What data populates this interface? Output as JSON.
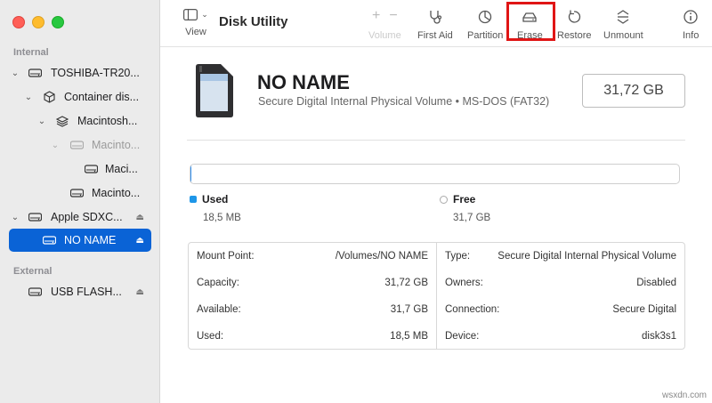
{
  "toolbar": {
    "view_label": "View",
    "app_title": "Disk Utility",
    "buttons": [
      {
        "label": "Volume",
        "icon": "plus-minus-icon"
      },
      {
        "label": "First Aid",
        "icon": "stethoscope-icon"
      },
      {
        "label": "Partition",
        "icon": "pie-icon"
      },
      {
        "label": "Erase",
        "icon": "erase-disk-icon"
      },
      {
        "label": "Restore",
        "icon": "restore-arrow-icon"
      },
      {
        "label": "Unmount",
        "icon": "unmount-icon"
      },
      {
        "label": "Info",
        "icon": "info-icon"
      }
    ]
  },
  "sidebar": {
    "internal_label": "Internal",
    "external_label": "External",
    "items": [
      {
        "label": "TOSHIBA-TR20..."
      },
      {
        "label": "Container dis..."
      },
      {
        "label": "Macintosh..."
      },
      {
        "label": "Macinto..."
      },
      {
        "label": "Maci..."
      },
      {
        "label": "Macinto..."
      },
      {
        "label": "Apple SDXC..."
      },
      {
        "label": "NO NAME"
      },
      {
        "label": "USB FLASH..."
      }
    ]
  },
  "volume": {
    "name": "NO NAME",
    "subtitle": "Secure Digital Internal Physical Volume • MS-DOS (FAT32)",
    "size": "31,72 GB",
    "used_fraction": 0.0006
  },
  "usage": {
    "used_label": "Used",
    "used_value": "18,5 MB",
    "free_label": "Free",
    "free_value": "31,7 GB"
  },
  "info": {
    "left": [
      {
        "key": "Mount Point:",
        "value": "/Volumes/NO NAME"
      },
      {
        "key": "Capacity:",
        "value": "31,72 GB"
      },
      {
        "key": "Available:",
        "value": "31,7 GB"
      },
      {
        "key": "Used:",
        "value": "18,5 MB"
      }
    ],
    "right": [
      {
        "key": "Type:",
        "value": "Secure Digital Internal Physical Volume"
      },
      {
        "key": "Owners:",
        "value": "Disabled"
      },
      {
        "key": "Connection:",
        "value": "Secure Digital"
      },
      {
        "key": "Device:",
        "value": "disk3s1"
      }
    ]
  },
  "watermark": "wsxdn.com",
  "colors": {
    "accent": "#0a63d6",
    "highlight": "#e01515"
  }
}
